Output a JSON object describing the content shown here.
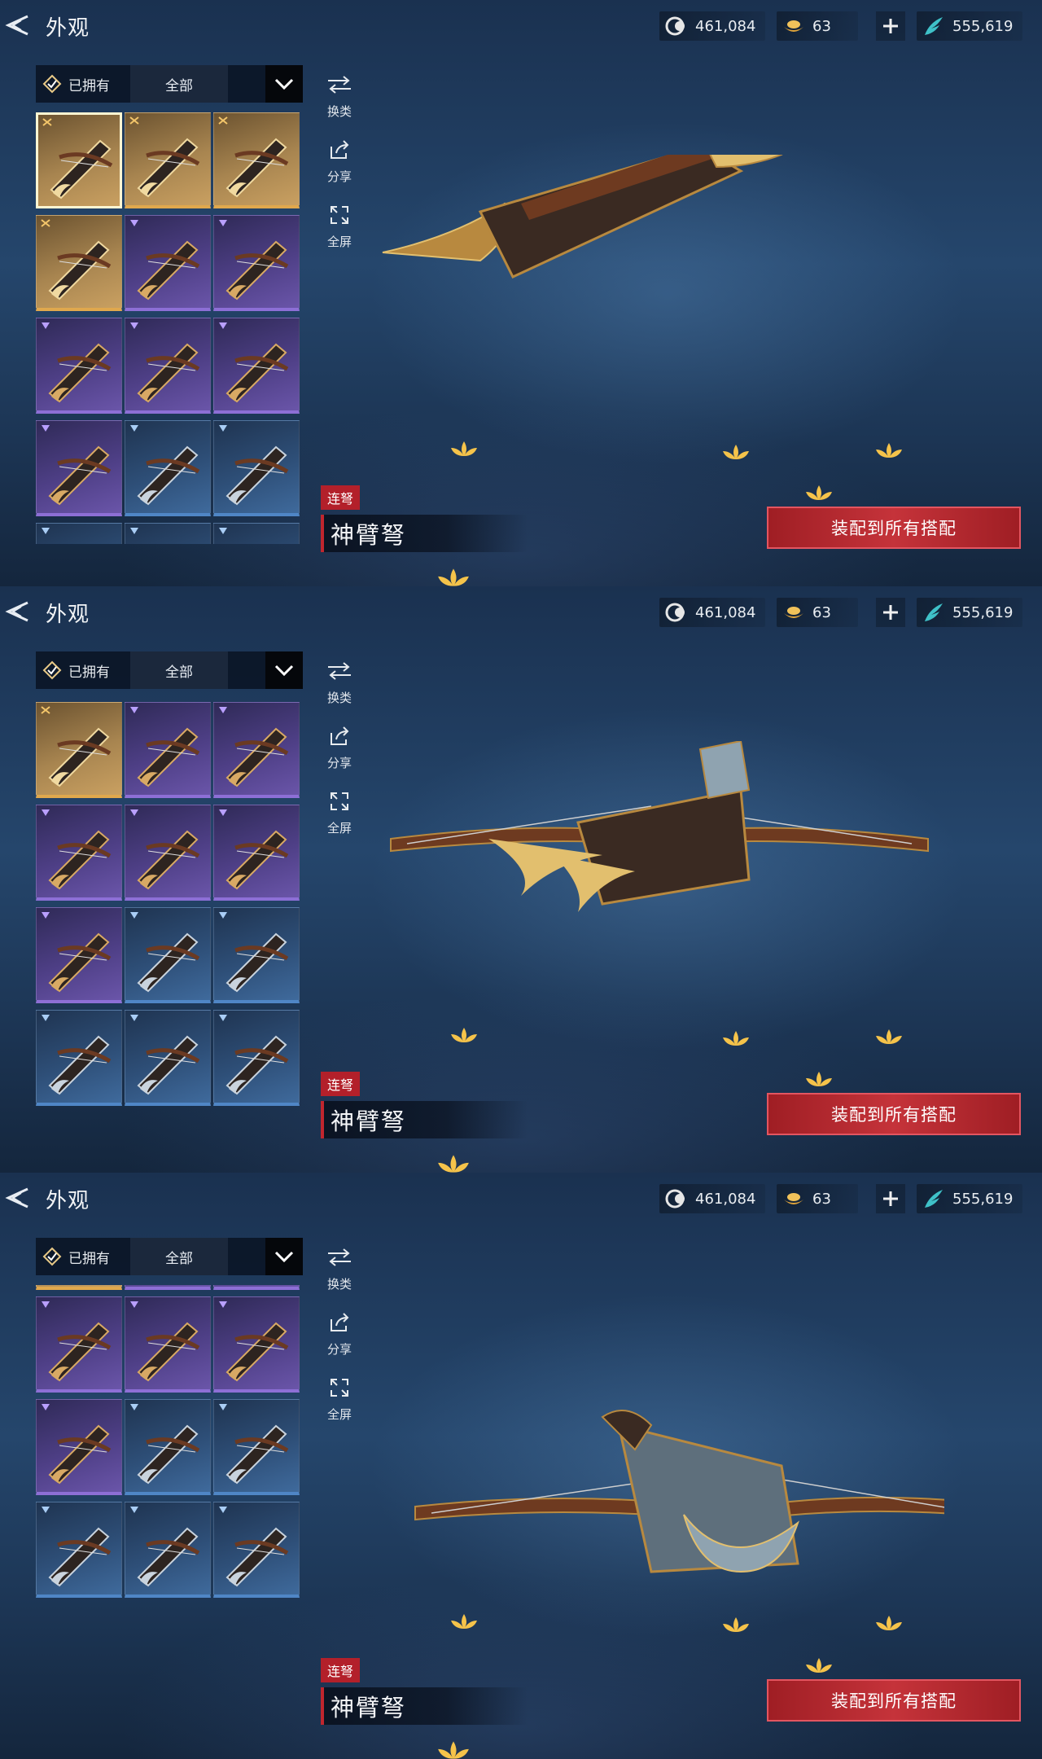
{
  "header": {
    "title": "外观",
    "currencies": [
      {
        "icon": "jade-coin-icon",
        "value": "461,084"
      },
      {
        "icon": "gold-ingot-icon",
        "value": "63"
      },
      {
        "icon": "feather-token-icon",
        "value": "555,619"
      }
    ]
  },
  "filter": {
    "owned_label": "已拥有",
    "category_label": "全部"
  },
  "side_actions": [
    {
      "icon": "swap-icon",
      "label": "换类"
    },
    {
      "icon": "share-icon",
      "label": "分享"
    },
    {
      "icon": "fullscreen-icon",
      "label": "全屏"
    }
  ],
  "item": {
    "type_label": "连弩",
    "name": "神臂弩"
  },
  "equip_button_label": "装配到所有搭配",
  "skin_grid": {
    "rarities": [
      "gold",
      "gold",
      "gold",
      "gold",
      "purple",
      "purple",
      "purple",
      "purple",
      "purple",
      "purple",
      "blue",
      "blue",
      "blue",
      "blue",
      "blue"
    ],
    "selected_index": 0
  },
  "colors": {
    "accent_red": "#c5333a",
    "gold_rarity": "#e0a84d",
    "purple_rarity": "#8d6fd6",
    "blue_rarity": "#4f86c6"
  }
}
